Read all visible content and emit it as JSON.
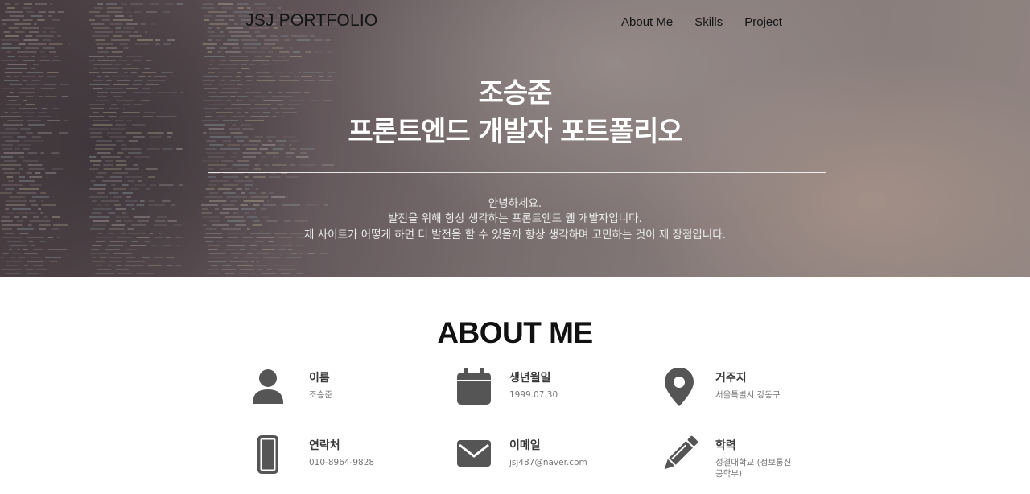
{
  "header": {
    "logo": "JSJ PORTFOLIO",
    "nav": [
      "About Me",
      "Skills",
      "Project"
    ]
  },
  "hero": {
    "title_line1": "조승준",
    "title_line2": "프론트엔드 개발자 포트폴리오",
    "desc_line1": "안녕하세요.",
    "desc_line2": "발전을 위해 항상 생각하는 프론트엔드 웹 개발자입니다.",
    "desc_line3": "제 사이트가 어떻게 하면 더 발전을 할 수 있을까 항상 생각하며 고민하는 것이 제 장점입니다."
  },
  "about": {
    "title": "ABOUT ME",
    "items": [
      {
        "icon": "user-icon",
        "label": "이름",
        "value": "조승준"
      },
      {
        "icon": "calendar-icon",
        "label": "생년월일",
        "value": "1999.07.30"
      },
      {
        "icon": "map-pin-icon",
        "label": "거주지",
        "value": "서울특별시 강동구"
      },
      {
        "icon": "mobile-phone-icon",
        "label": "연락처",
        "value": "010-8964-9828"
      },
      {
        "icon": "envelope-icon",
        "label": "이메일",
        "value": "jsj487@naver.com"
      },
      {
        "icon": "pencil-icon",
        "label": "학력",
        "value": "성결대학교 (정보통신공학부)"
      }
    ]
  },
  "colors": {
    "icon": "#555555",
    "hero_text": "#ffffff"
  }
}
